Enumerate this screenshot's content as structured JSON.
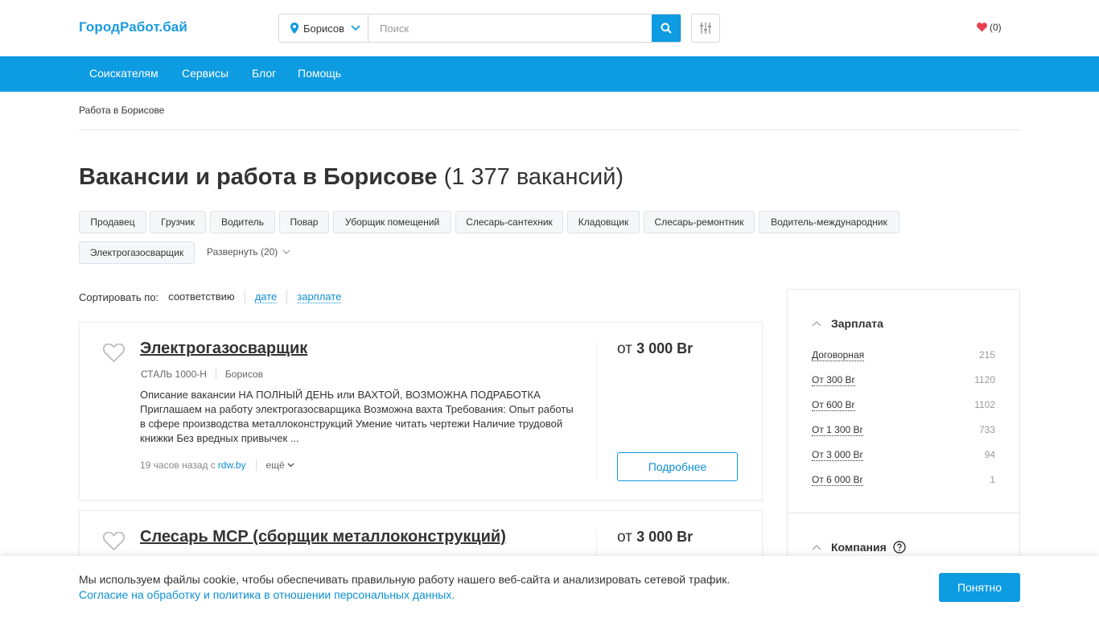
{
  "header": {
    "logo": "ГородРабот.бай",
    "city": "Борисов",
    "search_placeholder": "Поиск",
    "favorites_count": "(0)"
  },
  "nav": {
    "items": [
      "Соискателям",
      "Сервисы",
      "Блог",
      "Помощь"
    ]
  },
  "breadcrumb": "Работа в Борисове",
  "page": {
    "title": "Вакансии и работа в Борисове",
    "count": "(1 377 вакансий)"
  },
  "tags": [
    "Продавец",
    "Грузчик",
    "Водитель",
    "Повар",
    "Уборщик помещений",
    "Слесарь-сантехник",
    "Кладовщик",
    "Слесарь-ремонтник",
    "Водитель-международник",
    "Электрогазосварщик"
  ],
  "expand_label": "Развернуть (20)",
  "sort": {
    "label": "Сортировать по:",
    "current": "соответствию",
    "options": [
      "дате",
      "зарплате"
    ]
  },
  "vacancies": [
    {
      "title": "Электрогазосварщик",
      "company": "СТАЛЬ 1000-Н",
      "city": "Борисов",
      "description": "Описание вакансии НА ПОЛНЫЙ ДЕНЬ или ВАХТОЙ, ВОЗМОЖНА ПОДРАБОТКА Приглашаем на работу электрогазосварщика Возможна вахта Требования: Опыт работы в сфере производства металлоконструкций Умение читать чертежи Наличие трудовой книжки Без вредных привычек ...",
      "time": "19 часов назад с",
      "source": "rdw.by",
      "more": "ещё",
      "salary_prefix": "от",
      "salary": "3 000 Br",
      "details": "Подробнее"
    },
    {
      "title": "Слесарь МСР (сборщик металлоконструкций)",
      "salary_prefix": "от",
      "salary": "3 000 Br"
    }
  ],
  "sidebar": {
    "salary_title": "Зарплата",
    "salary_rows": [
      {
        "label": "Договорная",
        "count": "215"
      },
      {
        "label": "От 300 Br",
        "count": "1120"
      },
      {
        "label": "От 600 Br",
        "count": "1102"
      },
      {
        "label": "От 1 300 Br",
        "count": "733"
      },
      {
        "label": "От 3 000 Br",
        "count": "94"
      },
      {
        "label": "От 6 000 Br",
        "count": "1"
      }
    ],
    "company_title": "Компания"
  },
  "cookie": {
    "text": "Мы используем файлы cookie, чтобы обеспечивать правильную работу нашего веб-сайта и анализировать сетевой трафик.",
    "link": "Согласие на обработку и политика в отношении персональных данных.",
    "button": "Понятно"
  },
  "colors": {
    "accent": "#0d9be1",
    "favorite_heart": "#e8414e"
  }
}
